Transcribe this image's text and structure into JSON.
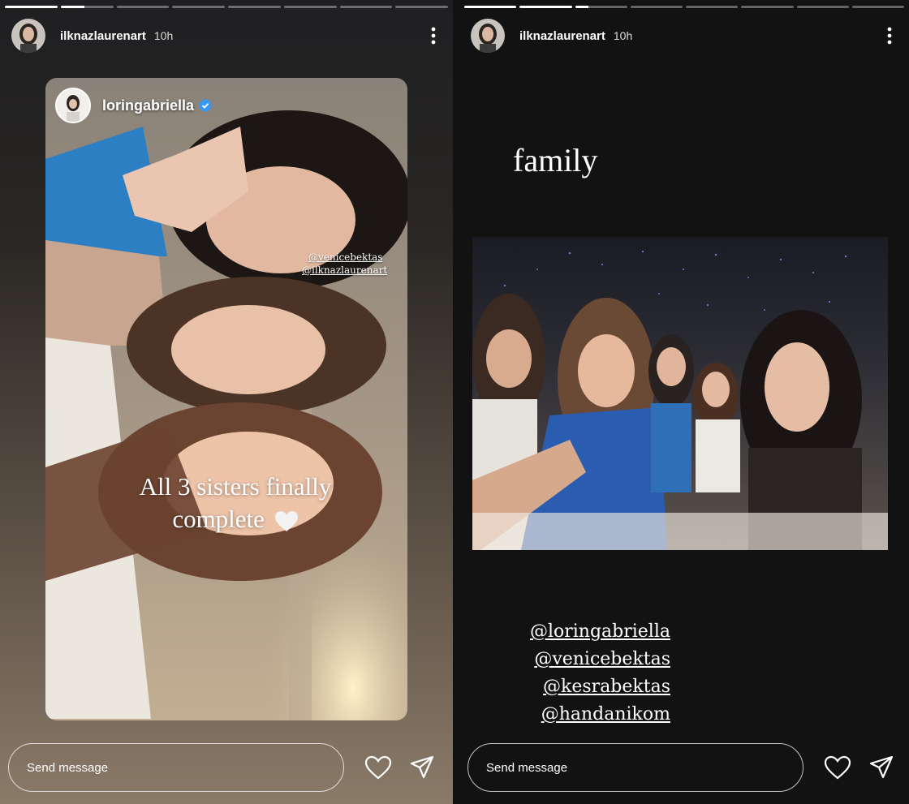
{
  "stories": [
    {
      "username": "ilknazlaurenart",
      "time": "10h",
      "progress": [
        1,
        0.45,
        0,
        0,
        0,
        0,
        0,
        0
      ],
      "reshared_from": "loringabriella",
      "reshared_verified": true,
      "inline_mentions": [
        "@venicebektas",
        "@ilknazlaurenart"
      ],
      "caption_line1": "All 3 sisters finally",
      "caption_line2": "complete",
      "caption_emoji": "white-heart",
      "send_placeholder": "Send message"
    },
    {
      "username": "ilknazlaurenart",
      "time": "10h",
      "progress": [
        1,
        1,
        0.25,
        0,
        0,
        0,
        0,
        0
      ],
      "text": "family",
      "mentions": [
        "@loringabriella",
        "@venicebektas",
        "@kesrabektas",
        "@handanikom"
      ],
      "send_placeholder": "Send message"
    }
  ],
  "icons": {
    "more": "more-vertical-icon",
    "like": "heart-icon",
    "share": "send-icon",
    "verified": "verified-badge-icon"
  },
  "colors": {
    "verified": "#3897f0",
    "text": "#ffffff"
  }
}
